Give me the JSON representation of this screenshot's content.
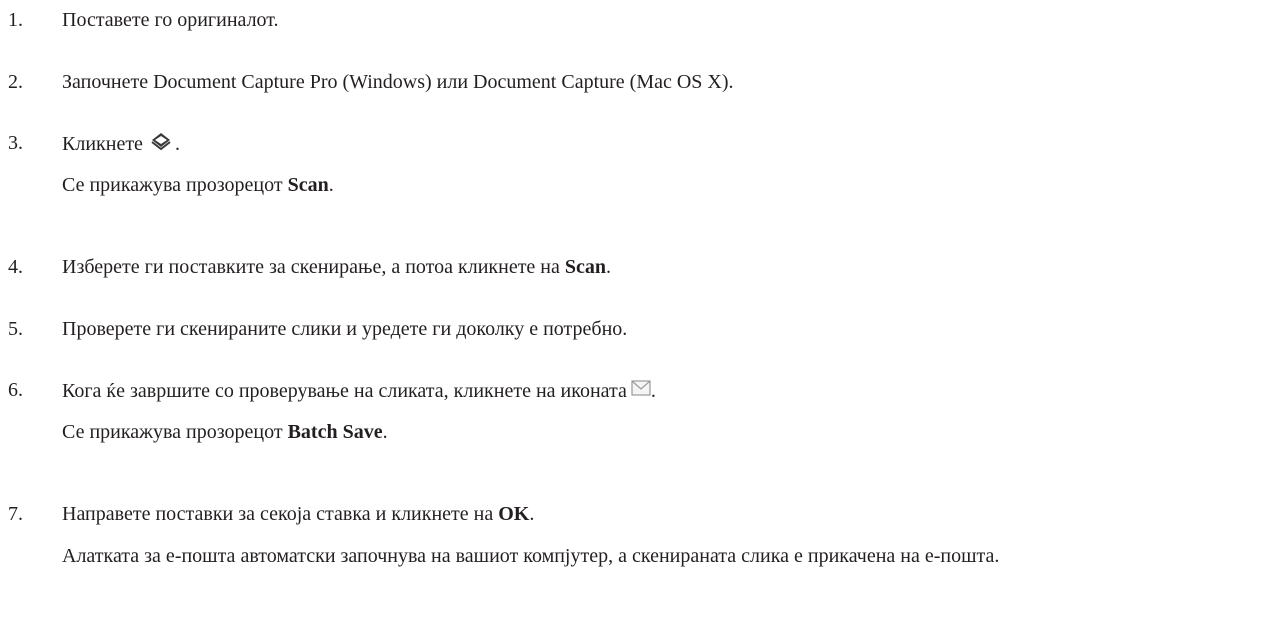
{
  "steps": [
    {
      "number": "1.",
      "text": "Поставете го оригиналот."
    },
    {
      "number": "2.",
      "text": "Започнете Document Capture Pro (Windows) или Document Capture (Mac OS X)."
    },
    {
      "number": "3.",
      "text_before": "Кликнете",
      "text_after": ".",
      "icon": "scanner-icon",
      "note_before": "Се прикажува прозорецот ",
      "note_bold": "Scan",
      "note_after": "."
    },
    {
      "number": "4.",
      "text_before": "Изберете ги поставките за скенирање, а потоа кликнете на ",
      "text_bold": "Scan",
      "text_after": "."
    },
    {
      "number": "5.",
      "text": "Проверете ги скенираните слики и уредете ги доколку е потребно."
    },
    {
      "number": "6.",
      "text_before": "Кога ќе завршите со проверување на сликата, кликнете на иконата",
      "text_after": ".",
      "icon": "email-icon",
      "note_before": "Се прикажува прозорецот ",
      "note_bold": "Batch Save",
      "note_after": "."
    },
    {
      "number": "7.",
      "text_before": "Направете поставки за секоја ставка и кликнете на ",
      "text_bold": "OK",
      "text_after": ".",
      "note": "Алатката за е-пошта автоматски започнува на вашиот компјутер, а скенираната слика е прикачена на е-пошта."
    }
  ]
}
